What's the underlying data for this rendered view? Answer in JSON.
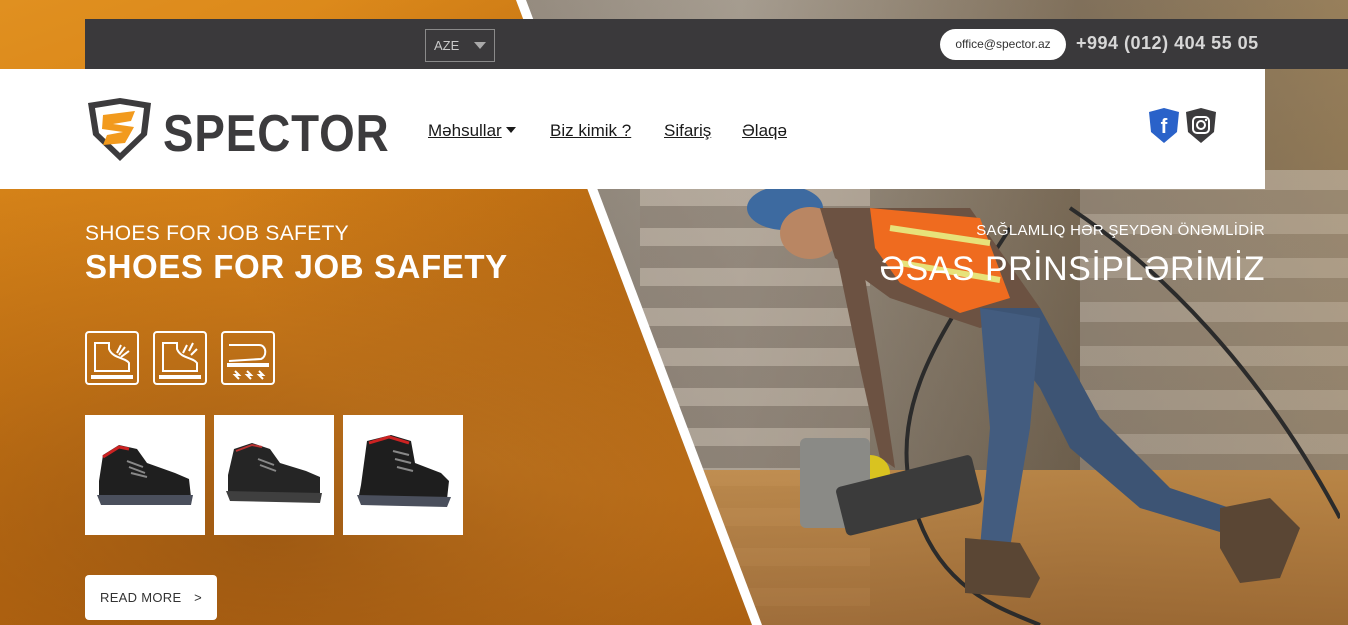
{
  "topbar": {
    "language": "AZE",
    "email": "office@spector.az",
    "phone": "+994 (012) 404 55 05"
  },
  "header": {
    "brand": "SPECTOR",
    "nav": [
      {
        "label": "Məhsullar",
        "has_dropdown": true
      },
      {
        "label": "Biz kimik ?"
      },
      {
        "label": "Sifariş"
      },
      {
        "label": "Əlaqə"
      }
    ],
    "social": [
      "facebook-icon",
      "instagram-icon"
    ]
  },
  "hero_left": {
    "subtitle": "SHOES FOR JOB SAFETY",
    "title": "SHOES FOR JOB SAFETY",
    "feature_icons": [
      "toe-protection-icon",
      "sole-protection-icon",
      "electrical-hazard-icon"
    ],
    "products": [
      "low-cut-shoe-red-accent",
      "low-cut-shoe-black",
      "mid-cut-boot-black"
    ],
    "read_more": "READ MORE",
    "read_more_arrow": ">"
  },
  "hero_right": {
    "subtitle": "SAĞLAMLIQ HƏR ŞEYDƏN ÖNƏMLİDİR",
    "title": "ƏSAS PRİNSİPLƏRİMİZ"
  },
  "colors": {
    "accent_orange": "#e0901c",
    "topbar_bg": "#3a393b",
    "logo_dark": "#3c3b3d",
    "facebook_blue": "#2a62c9"
  }
}
